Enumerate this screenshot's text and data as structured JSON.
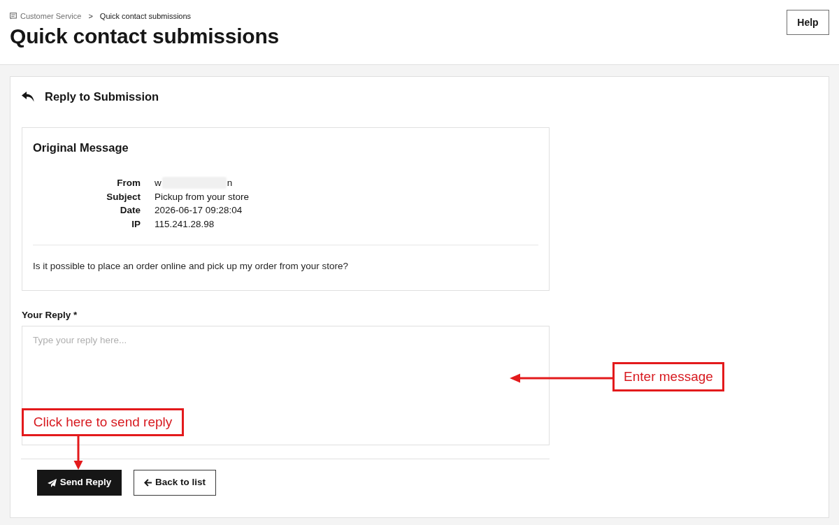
{
  "breadcrumb": {
    "items": [
      {
        "label": "Customer Service"
      },
      {
        "label": "Quick contact submissions"
      }
    ],
    "separator": ">"
  },
  "page_title": "Quick contact submissions",
  "help_button": {
    "label": "Help"
  },
  "card": {
    "title": "Reply to Submission"
  },
  "original_message": {
    "title": "Original Message",
    "fields": [
      {
        "label": "From",
        "value": "w",
        "value_end": "n",
        "redacted": true
      },
      {
        "label": "Subject",
        "value": "Pickup from your store",
        "redacted": false
      },
      {
        "label": "Date",
        "value": "2026-06-17 09:28:04",
        "redacted": false
      },
      {
        "label": "IP",
        "value": "115.241.28.98",
        "redacted": false
      }
    ],
    "body": "Is it possible to place an order online and pick up my order from your store?"
  },
  "reply": {
    "label": "Your Reply *",
    "placeholder": "Type your reply here..."
  },
  "buttons": [
    {
      "label": "Send Reply",
      "kind": "primary"
    },
    {
      "label": "Back to list",
      "kind": "secondary"
    }
  ],
  "annotations": [
    {
      "text": "Enter message",
      "kind": "arrow-left"
    },
    {
      "text": "Click here to send reply",
      "kind": "arrow-down"
    }
  ]
}
